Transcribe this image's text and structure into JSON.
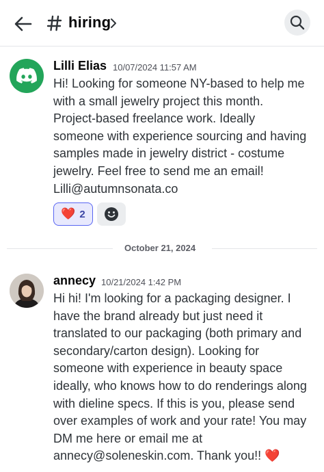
{
  "header": {
    "back_icon": "arrow-left-icon",
    "channel_icon": "hash-icon",
    "channel_name": "hiring",
    "chevron_icon": "chevron-right-icon",
    "search_icon": "search-icon"
  },
  "messages": [
    {
      "author": "Lilli Elias",
      "timestamp": "10/07/2024 11:57 AM",
      "avatar": "discord-logo-icon",
      "lines": [
        "Hi! Looking for someone NY-based to help me",
        "with a small jewelry project this month.",
        "Project-based freelance work. Ideally",
        "someone with experience sourcing and having",
        "samples made in jewelry district - costume",
        "jewelry. Feel free to send me an email!",
        "Lilli@autumnsonata.co"
      ],
      "reactions": [
        {
          "emoji": "❤️",
          "count": "2"
        }
      ],
      "add_reaction_icon": "add-reaction-icon"
    },
    {
      "author": "annecy",
      "timestamp": "10/21/2024 1:42 PM",
      "avatar": "user-photo",
      "lines": [
        "Hi hi! I'm looking for a packaging designer. I",
        "have the brand already but just need it",
        "translated to our packaging (both primary and",
        "secondary/carton design). Looking for",
        "someone with experience in beauty space",
        "ideally, who knows how to do renderings along",
        "with dieline specs. If this is you, please send",
        "over examples of work and your rate! You may",
        "DM me here or email me at",
        "annecy@soleneskin.com. Thank you!! ❤️"
      ]
    }
  ],
  "date_divider": "October 21, 2024",
  "colors": {
    "accent": "#5865f2",
    "discord_green": "#23a55a",
    "text": "#2e3338",
    "muted": "#4e5058"
  }
}
